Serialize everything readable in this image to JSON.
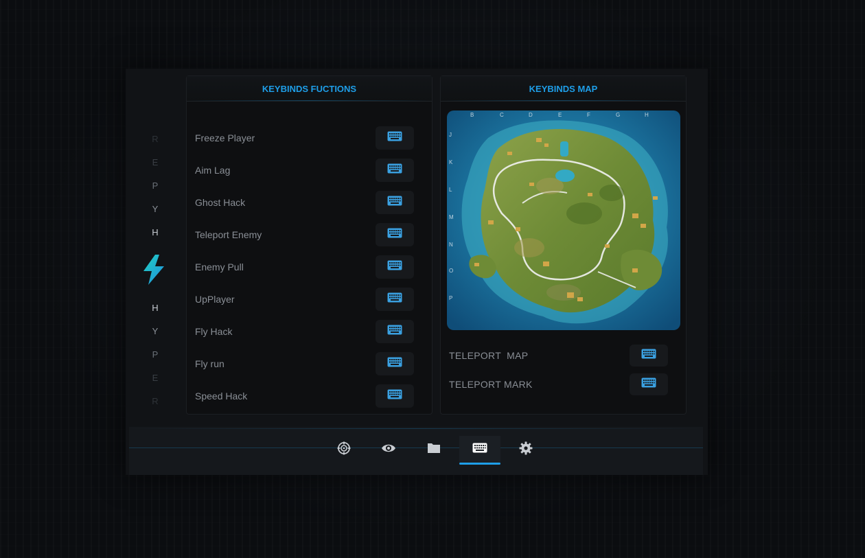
{
  "sidebar": {
    "letters_top": [
      "R",
      "E",
      "P",
      "Y",
      "H"
    ],
    "letters_bottom": [
      "H",
      "Y",
      "P",
      "E",
      "R"
    ],
    "logo_icon": "lightning-bolt-icon",
    "logo_colors": [
      "#21c4c4",
      "#1e9ee8"
    ]
  },
  "functions_panel": {
    "title": "KEYBINDS FUCTIONS",
    "items": [
      {
        "label": "Freeze Player",
        "icon": "keyboard-icon"
      },
      {
        "label": "Aim Lag",
        "icon": "keyboard-icon"
      },
      {
        "label": "Ghost Hack",
        "icon": "keyboard-icon"
      },
      {
        "label": "Teleport Enemy",
        "icon": "keyboard-icon"
      },
      {
        "label": "Enemy Pull",
        "icon": "keyboard-icon"
      },
      {
        "label": "UpPlayer",
        "icon": "keyboard-icon"
      },
      {
        "label": "Fly Hack",
        "icon": "keyboard-icon"
      },
      {
        "label": "Fly run",
        "icon": "keyboard-icon"
      },
      {
        "label": "Speed Hack",
        "icon": "keyboard-icon"
      }
    ]
  },
  "map_panel": {
    "title": "KEYBINDS MAP",
    "grid_columns": [
      "B",
      "C",
      "D",
      "E",
      "F",
      "G",
      "H"
    ],
    "grid_rows": [
      "J",
      "K",
      "L",
      "M",
      "N",
      "O",
      "P"
    ],
    "items": [
      {
        "label": "TELEPORT  MAP",
        "icon": "keyboard-icon"
      },
      {
        "label": "TELEPORT MARK",
        "icon": "keyboard-icon"
      }
    ]
  },
  "nav": {
    "items": [
      {
        "name": "aim",
        "icon": "crosshair-icon",
        "active": false
      },
      {
        "name": "visuals",
        "icon": "eye-icon",
        "active": false
      },
      {
        "name": "files",
        "icon": "folder-icon",
        "active": false
      },
      {
        "name": "keybinds",
        "icon": "keyboard-icon",
        "active": true
      },
      {
        "name": "settings",
        "icon": "gear-icon",
        "active": false
      }
    ]
  },
  "colors": {
    "accent": "#1e9ee8",
    "keyboard_icon": "#3aa0e0",
    "text_muted": "#8a8f96",
    "panel_bg": "#0e0f11"
  }
}
